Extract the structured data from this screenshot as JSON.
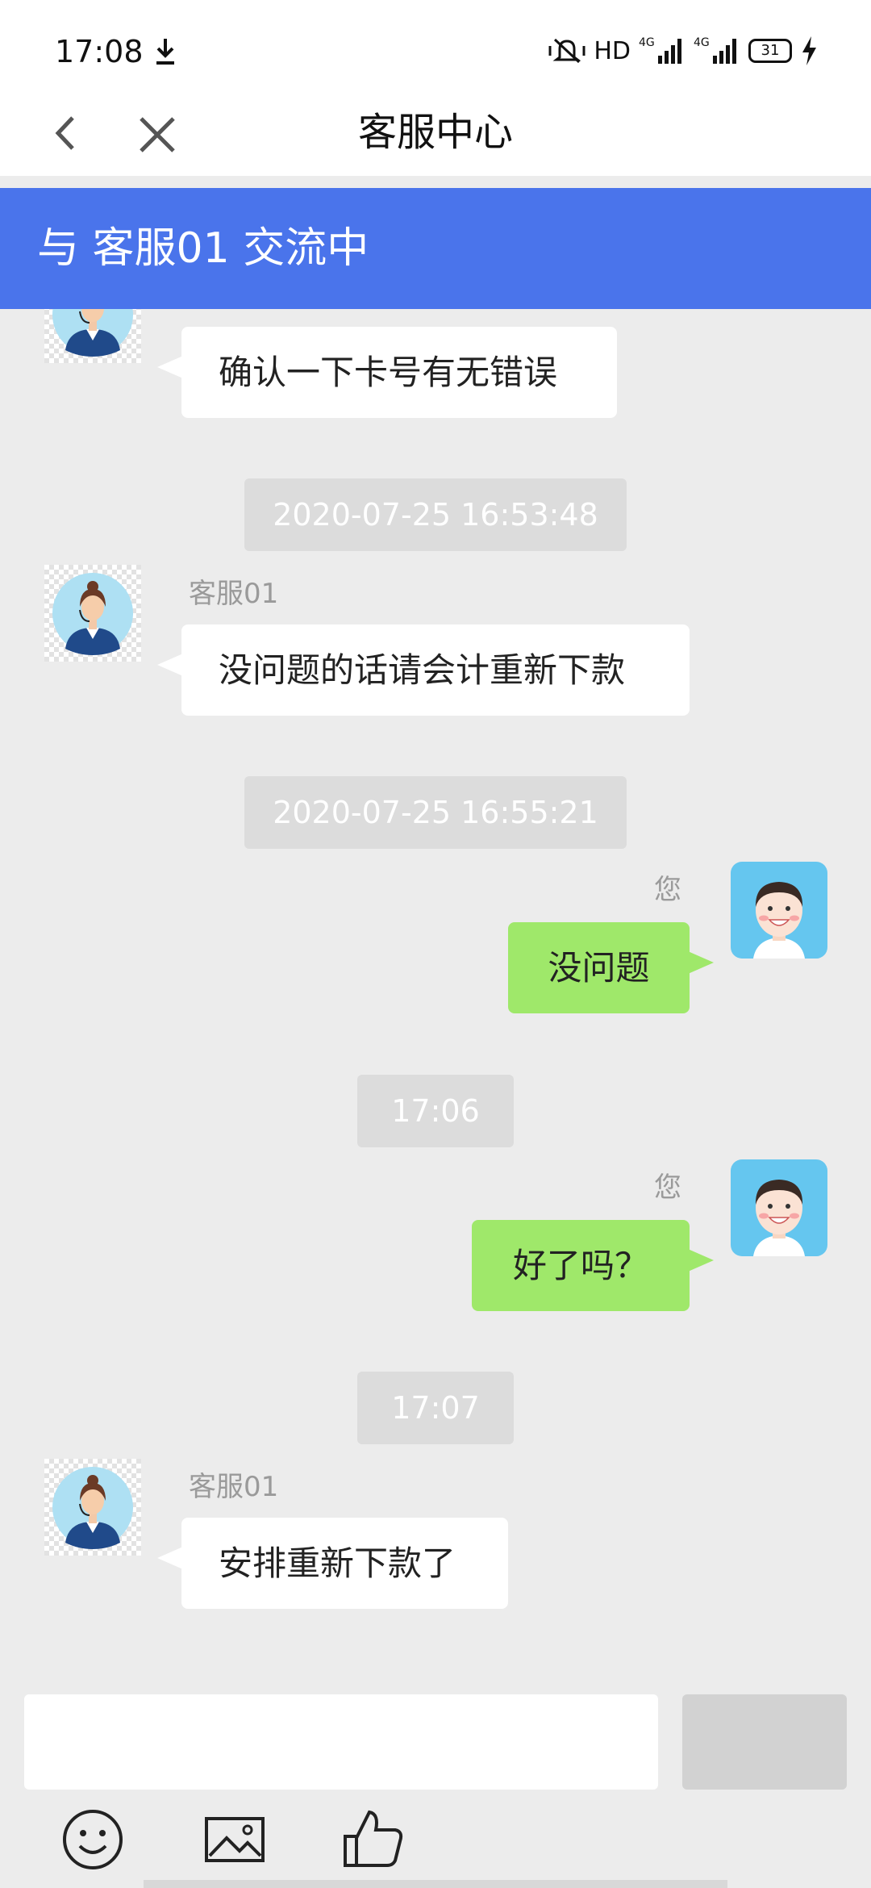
{
  "status_bar": {
    "time": "17:08",
    "indicators": "HD",
    "battery": "31",
    "icons": [
      "download-icon",
      "mute-icon",
      "signal-4g-icon",
      "signal-4g-icon",
      "battery-icon",
      "charging-icon"
    ]
  },
  "nav": {
    "title": "客服中心",
    "back_icon": "chevron-left-icon",
    "close_icon": "close-icon"
  },
  "banner": {
    "text": "与 客服01 交流中"
  },
  "messages": [
    {
      "sender": "agent",
      "name": "",
      "text": "确认一下卡号有无错误"
    },
    {
      "timestamp": "2020-07-25 16:53:48"
    },
    {
      "sender": "agent",
      "name": "客服01",
      "text": "没问题的话请会计重新下款"
    },
    {
      "timestamp": "2020-07-25 16:55:21"
    },
    {
      "sender": "user",
      "name": "您",
      "text": "没问题"
    },
    {
      "timestamp": "17:06"
    },
    {
      "sender": "user",
      "name": "您",
      "text": "好了吗？"
    },
    {
      "timestamp": "17:07"
    },
    {
      "sender": "agent",
      "name": "客服01",
      "text": "安排重新下款了"
    }
  ],
  "composer": {
    "input_value": "",
    "send_label": "",
    "tools": [
      "emoji-icon",
      "image-icon",
      "thumbs-up-icon"
    ]
  },
  "colors": {
    "banner": "#4a74eb",
    "background": "#ececec",
    "user_bubble": "#9fe86a",
    "agent_bubble": "#ffffff",
    "timestamp_bg": "#dcdcdc"
  }
}
